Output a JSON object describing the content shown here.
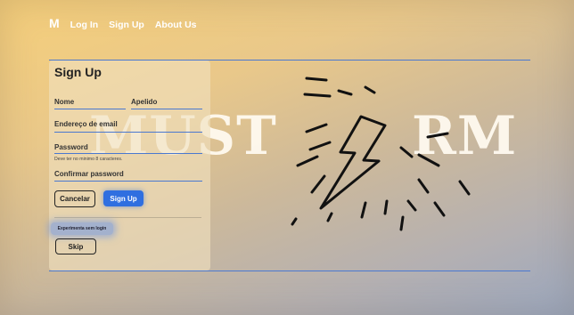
{
  "nav": {
    "brand": "M",
    "items": [
      {
        "label": "Log In"
      },
      {
        "label": "Sign Up"
      },
      {
        "label": "About Us"
      }
    ]
  },
  "hero": {
    "text_left": "MUST",
    "text_right": "RM"
  },
  "form": {
    "title": "Sign Up",
    "first_name_label": "Nome",
    "last_name_label": "Apelido",
    "email_label": "Endereço de email",
    "password_label": "Password",
    "password_hint": "Deve ter no minimo 8 caracteres.",
    "confirm_password_label": "Confirmar password",
    "cancel_label": "Cancelar",
    "signup_label": "Sign Up",
    "try_without_login_label": "Experimenta sem login",
    "skip_label": "Skip"
  },
  "colors": {
    "accent": "#2f6fe0",
    "line": "#4a78d0",
    "hero_text": "#fffaf0"
  },
  "icons": {
    "hero_graphic": "lightning-bolt-icon"
  }
}
